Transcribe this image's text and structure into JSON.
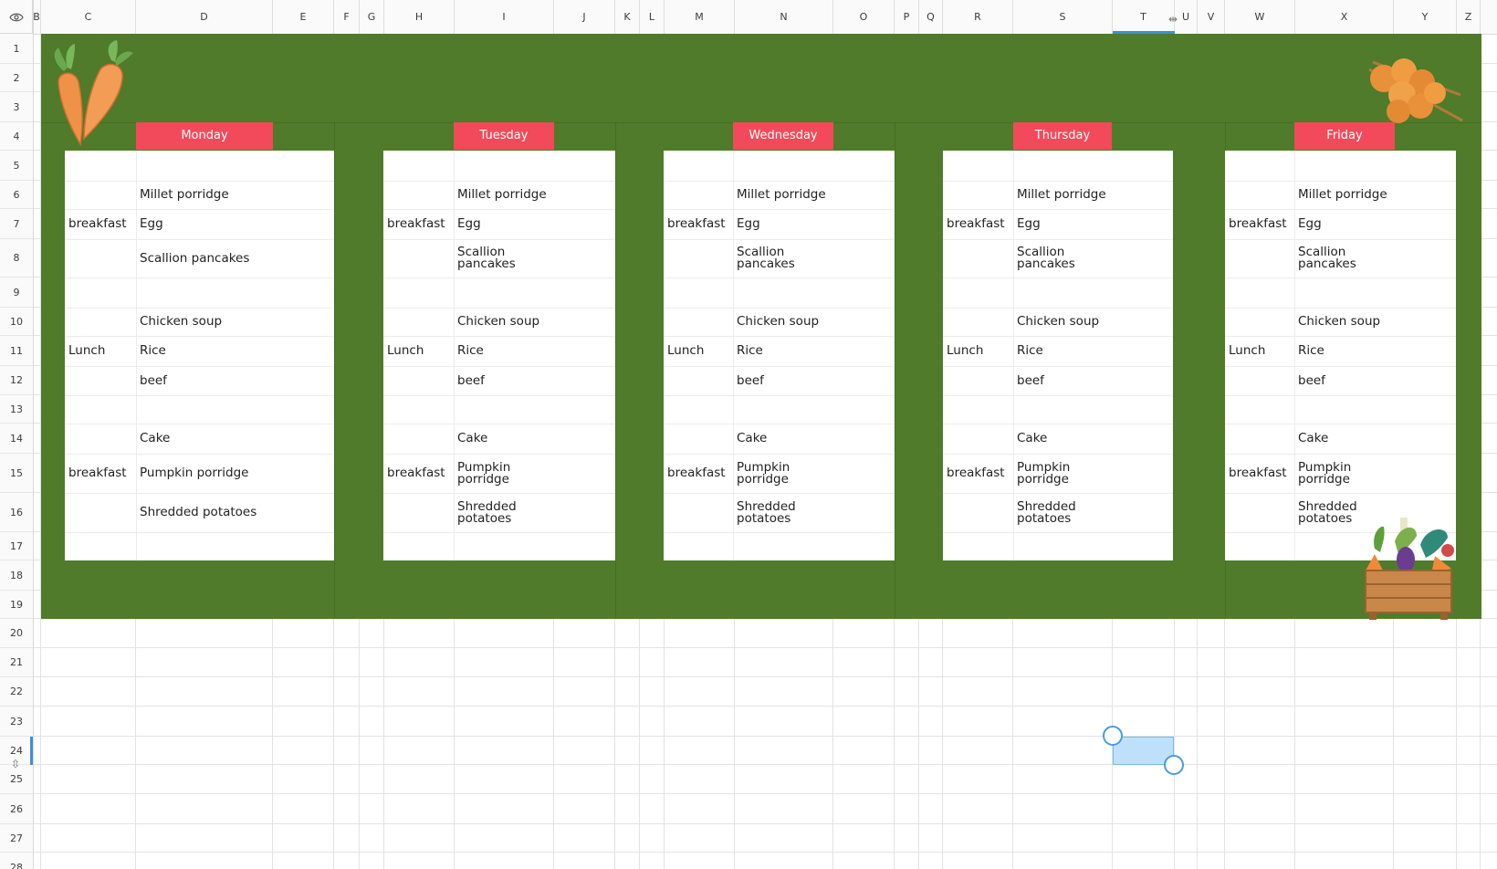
{
  "column_headers": [
    {
      "label": "B",
      "l": 36,
      "w": 9
    },
    {
      "label": "C",
      "l": 45,
      "w": 104
    },
    {
      "label": "D",
      "l": 149,
      "w": 150
    },
    {
      "label": "E",
      "l": 299,
      "w": 67
    },
    {
      "label": "F",
      "l": 366,
      "w": 28
    },
    {
      "label": "G",
      "l": 394,
      "w": 27
    },
    {
      "label": "H",
      "l": 421,
      "w": 77
    },
    {
      "label": "I",
      "l": 498,
      "w": 109
    },
    {
      "label": "J",
      "l": 607,
      "w": 67
    },
    {
      "label": "K",
      "l": 674,
      "w": 27
    },
    {
      "label": "L",
      "l": 701,
      "w": 27
    },
    {
      "label": "M",
      "l": 728,
      "w": 77
    },
    {
      "label": "N",
      "l": 805,
      "w": 108
    },
    {
      "label": "O",
      "l": 913,
      "w": 67
    },
    {
      "label": "P",
      "l": 980,
      "w": 27
    },
    {
      "label": "Q",
      "l": 1007,
      "w": 26
    },
    {
      "label": "R",
      "l": 1033,
      "w": 77
    },
    {
      "label": "S",
      "l": 1110,
      "w": 109
    },
    {
      "label": "T",
      "l": 1219,
      "w": 68
    },
    {
      "label": "U",
      "l": 1287,
      "w": 25
    },
    {
      "label": "V",
      "l": 1312,
      "w": 30
    },
    {
      "label": "W",
      "l": 1342,
      "w": 77
    },
    {
      "label": "X",
      "l": 1419,
      "w": 108
    },
    {
      "label": "Y",
      "l": 1527,
      "w": 69
    },
    {
      "label": "Z",
      "l": 1596,
      "w": 26
    }
  ],
  "row_headers": [
    "1",
    "2",
    "3",
    "4",
    "5",
    "6",
    "7",
    "8",
    "9",
    "10",
    "11",
    "12",
    "13",
    "14",
    "15",
    "16",
    "17",
    "18",
    "19",
    "20",
    "21",
    "22",
    "23",
    "24",
    "25",
    "26",
    "27",
    "28"
  ],
  "days": [
    {
      "name": "Monday",
      "breakfast_label": "breakfast",
      "breakfast": [
        "Millet porridge",
        "Egg",
        "Scallion pancakes"
      ],
      "lunch_label": "Lunch",
      "lunch": [
        "Chicken soup",
        "Rice",
        "beef"
      ],
      "dinner_label": "breakfast",
      "dinner": [
        "Cake",
        "Pumpkin porridge",
        "Shredded potatoes"
      ]
    },
    {
      "name": "Tuesday",
      "breakfast_label": "breakfast",
      "breakfast": [
        "Millet porridge",
        "Egg",
        "Scallion\npancakes"
      ],
      "lunch_label": "Lunch",
      "lunch": [
        "Chicken soup",
        "Rice",
        "beef"
      ],
      "dinner_label": "breakfast",
      "dinner": [
        "Cake",
        "Pumpkin\nporridge",
        "Shredded\npotatoes"
      ]
    },
    {
      "name": "Wednesday",
      "breakfast_label": "breakfast",
      "breakfast": [
        "Millet porridge",
        "Egg",
        "Scallion\npancakes"
      ],
      "lunch_label": "Lunch",
      "lunch": [
        "Chicken soup",
        "Rice",
        "beef"
      ],
      "dinner_label": "breakfast",
      "dinner": [
        "Cake",
        "Pumpkin\nporridge",
        "Shredded\npotatoes"
      ]
    },
    {
      "name": "Thursday",
      "breakfast_label": "breakfast",
      "breakfast": [
        "Millet porridge",
        "Egg",
        "Scallion\npancakes"
      ],
      "lunch_label": "Lunch",
      "lunch": [
        "Chicken soup",
        "Rice",
        "beef"
      ],
      "dinner_label": "breakfast",
      "dinner": [
        "Cake",
        "Pumpkin\nporridge",
        "Shredded\npotatoes"
      ]
    },
    {
      "name": "Friday",
      "breakfast_label": "breakfast",
      "breakfast": [
        "Millet porridge",
        "Egg",
        "Scallion\npancakes"
      ],
      "lunch_label": "Lunch",
      "lunch": [
        "Chicken soup",
        "Rice",
        "beef"
      ],
      "dinner_label": "breakfast",
      "dinner": [
        "Cake",
        "Pumpkin\nporridge",
        "Shredded\npotatoes"
      ]
    }
  ],
  "colors": {
    "banner_green": "#4f7b2a",
    "day_tab_red": "#f24a5a",
    "selection_blue": "#bfe0fb",
    "accent_blue": "#3d8fd6"
  },
  "icons": {
    "corner": "eye-icon",
    "decor_top_left": "carrot-illustration",
    "decor_top_right": "meatball-skewer-illustration",
    "decor_bottom_right": "vegetable-basket-illustration"
  },
  "selection": {
    "cell": "T24"
  }
}
